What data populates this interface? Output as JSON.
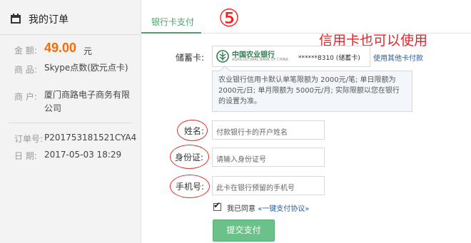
{
  "order": {
    "title": "我的订单",
    "amount_label": "金  额:",
    "amount_value": "49.00",
    "amount_unit": "元",
    "product_label": "商  品:",
    "product_value": "Skype点数(欧元点卡)",
    "merchant_label": "商  户:",
    "merchant_value": "厦门商路电子商务有限公司",
    "order_no_label": "订单号:",
    "order_no_value": "P201753181521CYA4",
    "date_label": "日  期:",
    "date_value": "2017-05-03 18:29"
  },
  "tabs": {
    "active": "银行卡支付"
  },
  "annotations": {
    "step": "⑤",
    "note": "信用卡也可以使用"
  },
  "card": {
    "label": "储蓄卡:",
    "bank_name": "中国农业银行",
    "bank_sub": "AGRICULTURAL BANK OF CHINA",
    "card_no": "******8310 (储蓄卡)",
    "other_link": "使用其他卡付款"
  },
  "limit_info": "农业银行信用卡默认单笔限额为 2000元/笔;  单日限额为 2000元/日;  单月限额为 5000元/月;  实际限额以您在银行的设置为准。",
  "form": {
    "name_label": "姓名:",
    "name_placeholder": "付款银行卡的开户姓名",
    "id_label": "身份证:",
    "id_placeholder": "请输入身份证号",
    "phone_label": "手机号:",
    "phone_placeholder": "此卡在银行预留的手机号",
    "agree_text": "我已同意",
    "agree_link": "«一键支付协议»",
    "submit": "提交支付"
  },
  "colors": {
    "accent": "#4aa36f",
    "amount": "#ff6a00",
    "annotation": "#e8232b",
    "button": "#6cc08a"
  }
}
